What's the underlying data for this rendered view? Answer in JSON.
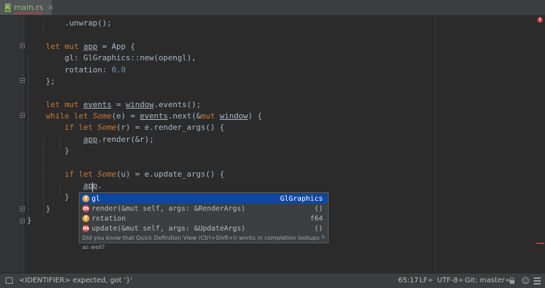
{
  "tabs": [
    {
      "label": "main.rs",
      "close": "×",
      "file_glyph": "R"
    }
  ],
  "editor": {
    "lines": [
      [
        {
          "t": "        .unwrap();"
        }
      ],
      [],
      [
        {
          "t": "    "
        },
        {
          "t": "let mut ",
          "c": "kw"
        },
        {
          "t": "app",
          "c": "und"
        },
        {
          "t": " = App {"
        }
      ],
      [
        {
          "t": "        gl: GlGraphics::new(opengl),"
        }
      ],
      [
        {
          "t": "        rotation: "
        },
        {
          "t": "0.0",
          "c": "num"
        }
      ],
      [
        {
          "t": "    };"
        }
      ],
      [],
      [
        {
          "t": "    "
        },
        {
          "t": "let mut ",
          "c": "kw"
        },
        {
          "t": "events",
          "c": "und"
        },
        {
          "t": " = "
        },
        {
          "t": "window",
          "c": "und"
        },
        {
          "t": ".events();"
        }
      ],
      [
        {
          "t": "    "
        },
        {
          "t": "while let ",
          "c": "kw"
        },
        {
          "t": "Some",
          "c": "it"
        },
        {
          "t": "(e) = "
        },
        {
          "t": "events",
          "c": "und"
        },
        {
          "t": ".next(&"
        },
        {
          "t": "mut ",
          "c": "kw"
        },
        {
          "t": "window",
          "c": "und"
        },
        {
          "t": ") {"
        }
      ],
      [
        {
          "t": "        "
        },
        {
          "t": "if let ",
          "c": "kw"
        },
        {
          "t": "Some",
          "c": "it"
        },
        {
          "t": "(r) = e.render_args() {"
        }
      ],
      [
        {
          "t": "            "
        },
        {
          "t": "app",
          "c": "und"
        },
        {
          "t": ".render(&r);"
        }
      ],
      [
        {
          "t": "        }"
        }
      ],
      [],
      [
        {
          "t": "        "
        },
        {
          "t": "if let ",
          "c": "kw"
        },
        {
          "t": "Some",
          "c": "it"
        },
        {
          "t": "(u) = e.update_args() {"
        }
      ],
      [
        {
          "t": "            "
        },
        {
          "t": "app",
          "c": "und"
        },
        {
          "t": "."
        }
      ],
      [
        {
          "t": "        }"
        }
      ],
      [
        {
          "t": "    }"
        }
      ],
      [
        {
          "t": "}"
        }
      ]
    ],
    "error_marker": "!"
  },
  "completion": {
    "items": [
      {
        "kind": "f",
        "name": "gl",
        "type": "GlGraphics",
        "selected": true
      },
      {
        "kind": "m",
        "name": "render(&mut self, args: &RenderArgs)",
        "type": "()",
        "selected": false
      },
      {
        "kind": "f",
        "name": "rotation",
        "type": "f64",
        "selected": false
      },
      {
        "kind": "m",
        "name": "update(&mut self, args: &UpdateArgs)",
        "type": "()",
        "selected": false
      }
    ],
    "hint": "Did you know that Quick Definition View (Ctrl+Shift+I) works in completion lookups as well?",
    "hint_icon": "π"
  },
  "status": {
    "message": "<IDENTIFIER> expected, got '}'",
    "position": "65:17",
    "line_separator": "LF÷",
    "encoding": "UTF-8÷",
    "vcs": "Git: master÷"
  },
  "colors": {
    "selection": "#0d47a1",
    "keyword": "#cc7832",
    "number": "#6897bb",
    "error": "#c4403b"
  }
}
